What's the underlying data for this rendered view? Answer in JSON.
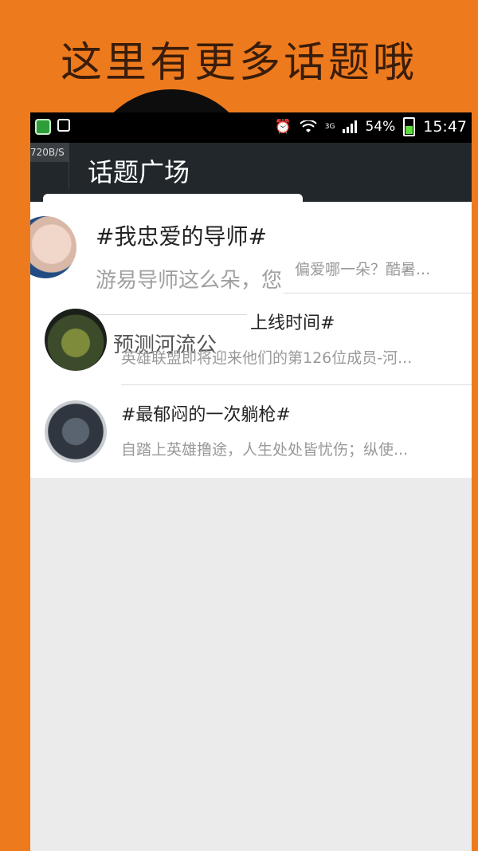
{
  "promo": {
    "title": "这里有更多话题哦"
  },
  "statusbar": {
    "battery": "54%",
    "time": "15:47",
    "network": "3G",
    "speed": "720B/S",
    "battery_level": 0.54
  },
  "appbar": {
    "title": "话题广场"
  },
  "topics": [
    {
      "title": "#我忠爱的导师#",
      "desc_left": "游易导师这么朵，您",
      "desc_right": "偏爱哪一朵？酷暑..."
    },
    {
      "title_left": "预测河流公",
      "title_right": "上线时间#",
      "desc": "英雄联盟即将迎来他们的第126位成员-河..."
    },
    {
      "title": "#最郁闷的一次躺枪#",
      "desc": "自踏上英雄撸途，人生处处皆忧伤；纵使..."
    }
  ],
  "colors": {
    "background": "#EE7A1E",
    "appbar": "#22272b",
    "list_bg": "#ffffff",
    "empty_bg": "#ebebeb"
  }
}
